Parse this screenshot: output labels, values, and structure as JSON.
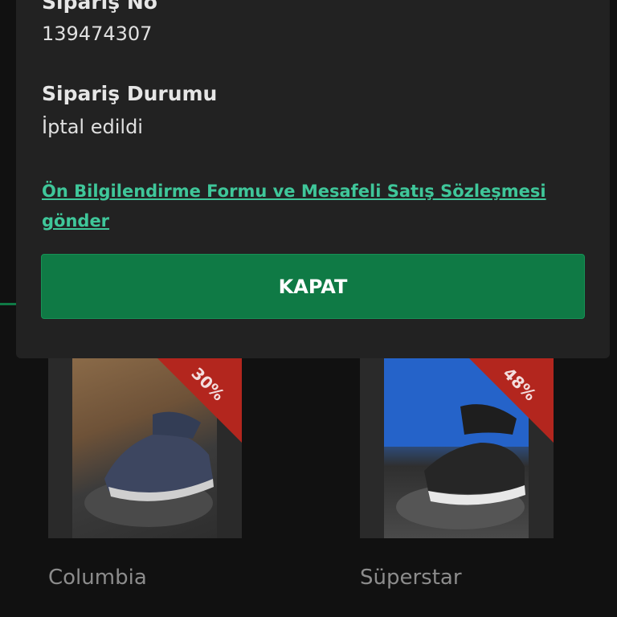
{
  "modal": {
    "order_no_label": "Sipariş No",
    "order_no_value": "139474307",
    "status_label": "Sipariş Durumu",
    "status_value": "İptal edildi",
    "contract_link": "Ön Bilgilendirme Formu ve Mesafeli Satış Sözleşmesi gönder",
    "close_button": "KAPAT"
  },
  "products": [
    {
      "name": "Columbia",
      "discount": "30%"
    },
    {
      "name": "Süperstar",
      "discount": "48%"
    }
  ],
  "colors": {
    "accent_green": "#0f7a45",
    "link_green": "#3fc79a",
    "discount_red": "#b3261e",
    "modal_bg": "#222222",
    "page_bg": "#111111"
  }
}
